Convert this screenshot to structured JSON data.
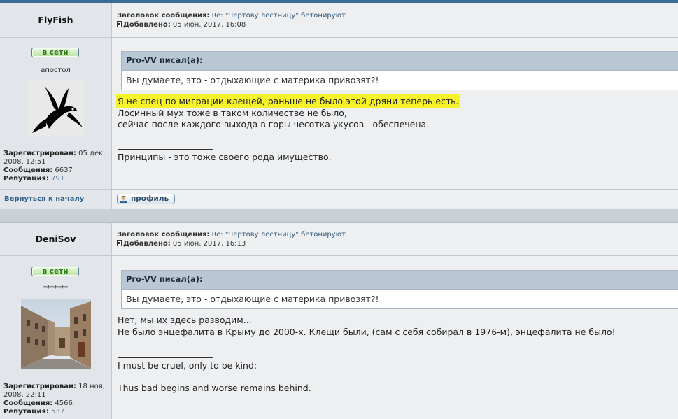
{
  "posts": [
    {
      "username": "FlyFish",
      "subject_label": "Заголовок сообщения:",
      "subject": "Re: \"Чертову лестницу\" бетонируют",
      "added_label": "Добавлено:",
      "added": "05 июн, 2017, 16:08",
      "online_label": "в сети",
      "rank": "апостол",
      "registered_label": "Зарегистрирован:",
      "registered_1": "05 дек,",
      "registered_2": "2008, 12:51",
      "messages_label": "Сообщения:",
      "messages": "6637",
      "reputation_label": "Репутация:",
      "reputation": "791",
      "quote_author": "Pro-VV писал(а):",
      "quote_text": "Вы думаете, это - отдыхающие с материка привозят?!",
      "body_lines": [
        "Я не спец по миграции клещей, раньше не было этой дряни теперь есть.",
        "Лосинный мух тоже в таком количестве не было,",
        "сейчас после каждого выхода в горы чесотка укусов - обеспечена."
      ],
      "signature": "Принципы - это тоже своего рода имущество.",
      "back_to_top": "Вернуться к началу",
      "profile_label": "профиль"
    },
    {
      "username": "DeniSov",
      "subject_label": "Заголовок сообщения:",
      "subject": "Re: \"Чертову лестницу\" бетонируют",
      "added_label": "Добавлено:",
      "added": "05 июн, 2017, 16:13",
      "online_label": "в сети",
      "rank": "*******",
      "registered_label": "Зарегистрирован:",
      "registered_1": "18 ноя,",
      "registered_2": "2008, 22:11",
      "messages_label": "Сообщения:",
      "messages": "4566",
      "reputation_label": "Репутация:",
      "reputation": "537",
      "quote_author": "Pro-VV писал(а):",
      "quote_text": "Вы думаете, это - отдыхающие с материка привозят?!",
      "body_lines": [
        "Нет, мы их здесь разводим...",
        "Не было энцефалита в Крыму до 2000-х. Клещи были, (сам с себя собирал в 1976-м), энцефалита не было!"
      ],
      "signature_lines": [
        "I must be cruel, only to be kind:",
        "Thus bad begins and worse remains behind."
      ]
    }
  ],
  "icons": {
    "post": "post-icon",
    "avatar1": "bat-winged-fish-avatar",
    "avatar2": "building-courtyard-photo-avatar",
    "profile": "profile-icon"
  }
}
